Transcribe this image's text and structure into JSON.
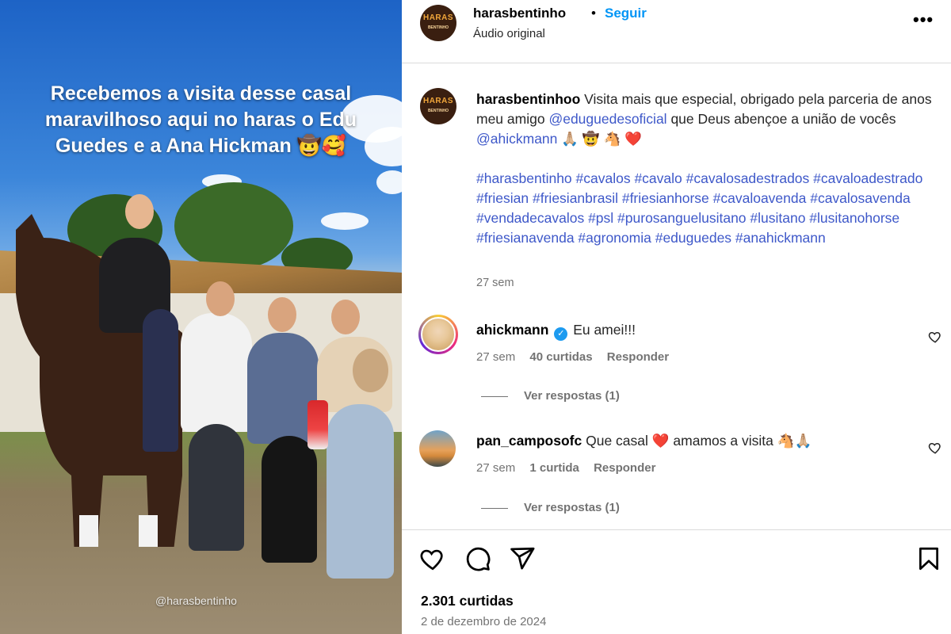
{
  "photo": {
    "overlay_text": "Recebemos a visita desse casal maravilhoso aqui no haras o Edu Guedes e a Ana Hickman 🤠🥰",
    "watermark": "@harasbentinho"
  },
  "header": {
    "avatar_text_line1": "HARAS",
    "avatar_text_line2": "BENTINHO",
    "username": "harasbentinho",
    "separator": "•",
    "follow_label": "Seguir",
    "audio_label": "Áudio original",
    "more_label": "•••"
  },
  "caption": {
    "username": "harasbentinhoo",
    "text_part1": "Visita mais que especial, obrigado pela parceria de anos meu amigo",
    "mention1": "@eduguedesoficial",
    "text_part2": "que Deus abençoe a união de vocês",
    "mention2": "@ahickmann",
    "emojis": "🙏🏼 🤠 🐴 ❤️",
    "hashtags": "#harasbentinho #cavalos #cavalo #cavalosadestrados #cavaloadestrado #friesian #friesianbrasil #friesianhorse #cavaloavenda #cavalosavenda #vendadecavalos #psl #purosanguelusitano #lusitano #lusitanohorse #friesianavenda #agronomia #eduguedes #anahickmann",
    "time": "27 sem"
  },
  "comments": [
    {
      "username": "ahickmann",
      "verified_mark": "✓",
      "text": "Eu amei!!!",
      "time": "27 sem",
      "likes": "40 curtidas",
      "reply_label": "Responder",
      "view_replies": "Ver respostas (1)"
    },
    {
      "username": "pan_camposofc",
      "text": "Que casal ❤️  amamos a visita 🐴🙏🏼",
      "time": "27 sem",
      "likes": "1 curtida",
      "reply_label": "Responder",
      "view_replies": "Ver respostas (1)"
    }
  ],
  "footer": {
    "likes": "2.301 curtidas",
    "date": "2 de dezembro de 2024"
  },
  "colors": {
    "link": "#3e58c9",
    "follow": "#0095f6",
    "muted": "#737373"
  }
}
